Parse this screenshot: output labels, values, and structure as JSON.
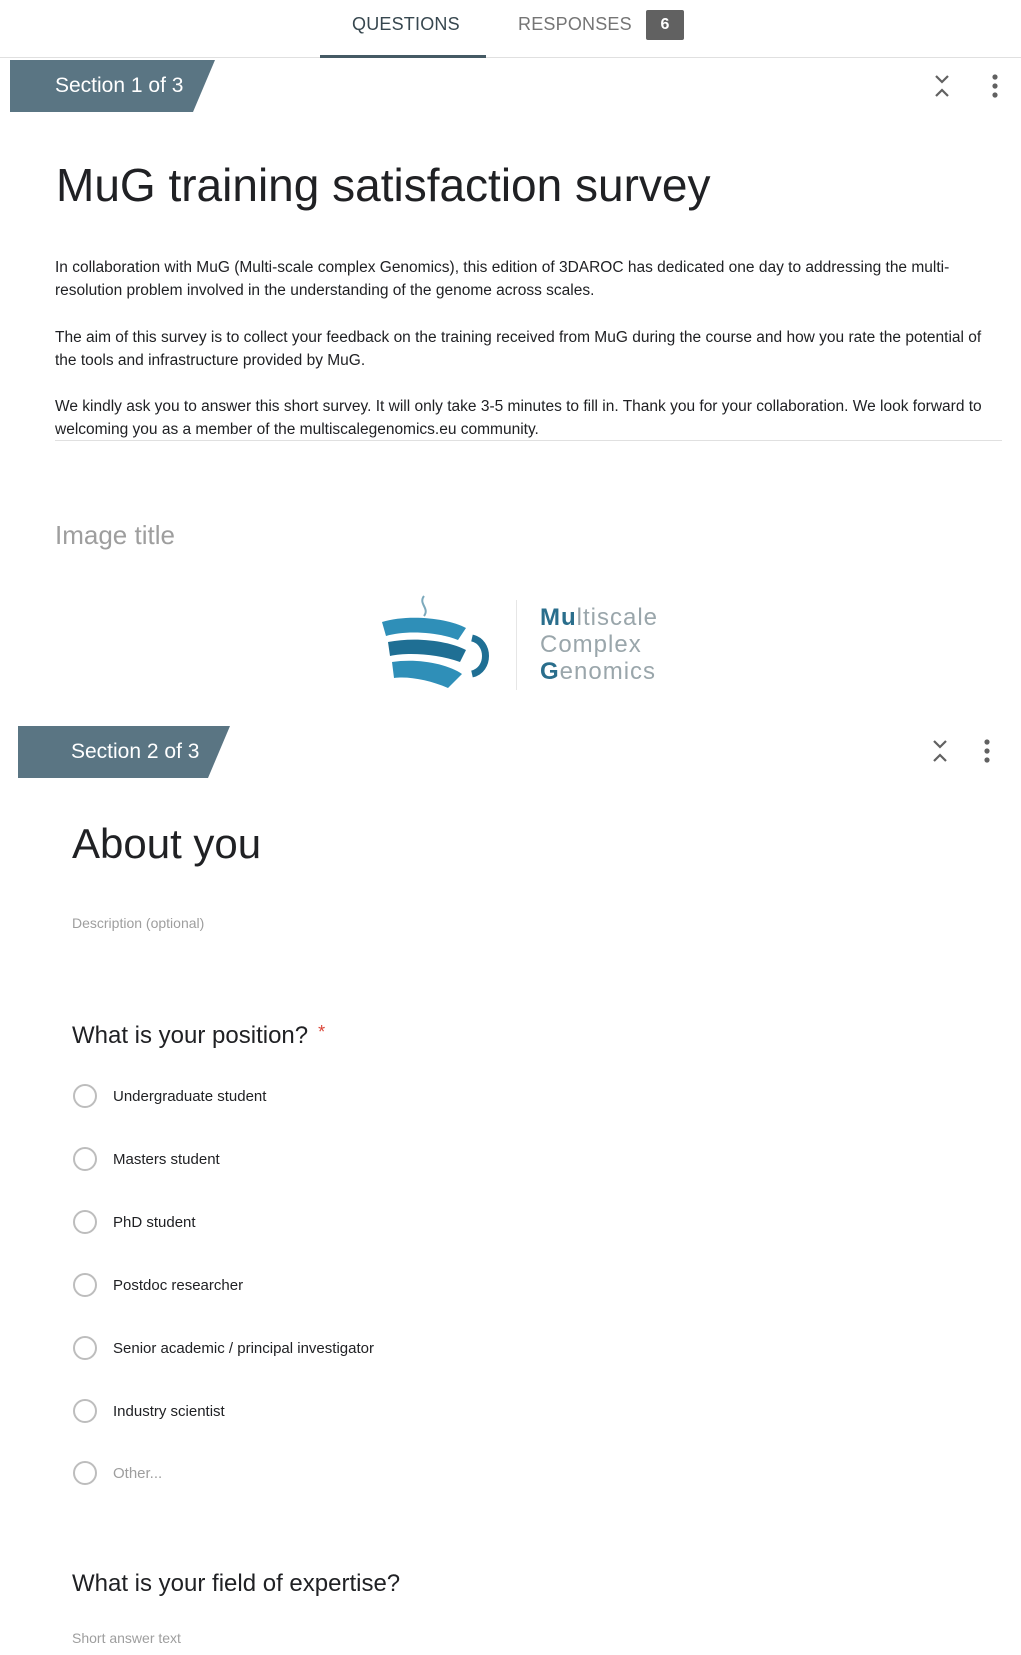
{
  "tabs": {
    "questions": "QUESTIONS",
    "responses": "RESPONSES",
    "responses_count": "6"
  },
  "sections": [
    {
      "label": "Section 1 of 3",
      "title": "MuG training satisfaction survey",
      "description": [
        "In collaboration with MuG (Multi-scale complex Genomics), this edition of 3DAROC has dedicated one day to addressing the multi-resolution problem involved in the understanding of the genome across scales.",
        "The aim of this survey is to collect your feedback on the training received from MuG during the course and how you rate the potential of the tools and infrastructure provided by MuG.",
        "We kindly ask you to answer this short survey. It will only take 3-5 minutes to fill in. Thank you for your collaboration. We look forward to welcoming you as a member of the multiscalegenomics.eu community."
      ],
      "image_title_placeholder": "Image title",
      "logo": {
        "line1_strong": "Mu",
        "line1_light": "ltiscale",
        "line2_light": "Complex",
        "line3_strong": "G",
        "line3_light": "enomics"
      }
    },
    {
      "label": "Section 2 of 3",
      "title": "About you",
      "description_placeholder": "Description (optional)",
      "questions": [
        {
          "title": "What is your position?",
          "required_marker": "*",
          "options": [
            "Undergraduate student",
            "Masters student",
            "PhD student",
            "Postdoc researcher",
            "Senior academic / principal investigator",
            "Industry scientist",
            "Other..."
          ]
        },
        {
          "title": "What is your field of expertise?",
          "answer_placeholder": "Short answer text"
        }
      ]
    }
  ],
  "icons": {
    "collapse": "collapse-icon",
    "more": "more-vert-icon"
  },
  "colors": {
    "section_band": "#5a7583",
    "tab_active": "#455a64",
    "badge": "#616161",
    "required": "#db4437",
    "logo_blue": "#2a6e8c"
  }
}
